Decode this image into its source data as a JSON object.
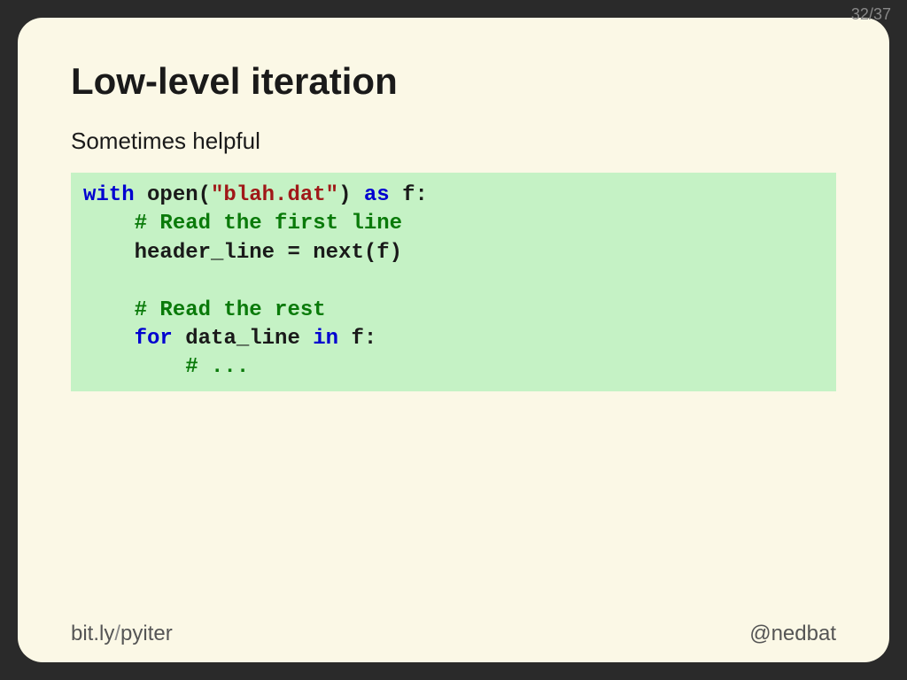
{
  "page": {
    "current": "32",
    "separator": "/",
    "total": "37"
  },
  "slide": {
    "title": "Low-level iteration",
    "subtitle": "Sometimes helpful"
  },
  "code": {
    "line1": {
      "kw1": "with",
      "sp1": " open(",
      "str": "\"blah.dat\"",
      "sp2": ") ",
      "kw2": "as",
      "sp3": " f:"
    },
    "line2": {
      "indent": "    ",
      "cm": "# Read the first line"
    },
    "line3": {
      "text": "    header_line = next(f)"
    },
    "line4": {
      "text": ""
    },
    "line5": {
      "indent": "    ",
      "cm": "# Read the rest"
    },
    "line6": {
      "indent": "    ",
      "kw1": "for",
      "mid": " data_line ",
      "kw2": "in",
      "tail": " f:"
    },
    "line7": {
      "indent": "        ",
      "cm": "# ..."
    }
  },
  "footer": {
    "link_domain": "bit.ly",
    "link_slash": "/",
    "link_path": "pyiter",
    "handle": "@nedbat"
  }
}
